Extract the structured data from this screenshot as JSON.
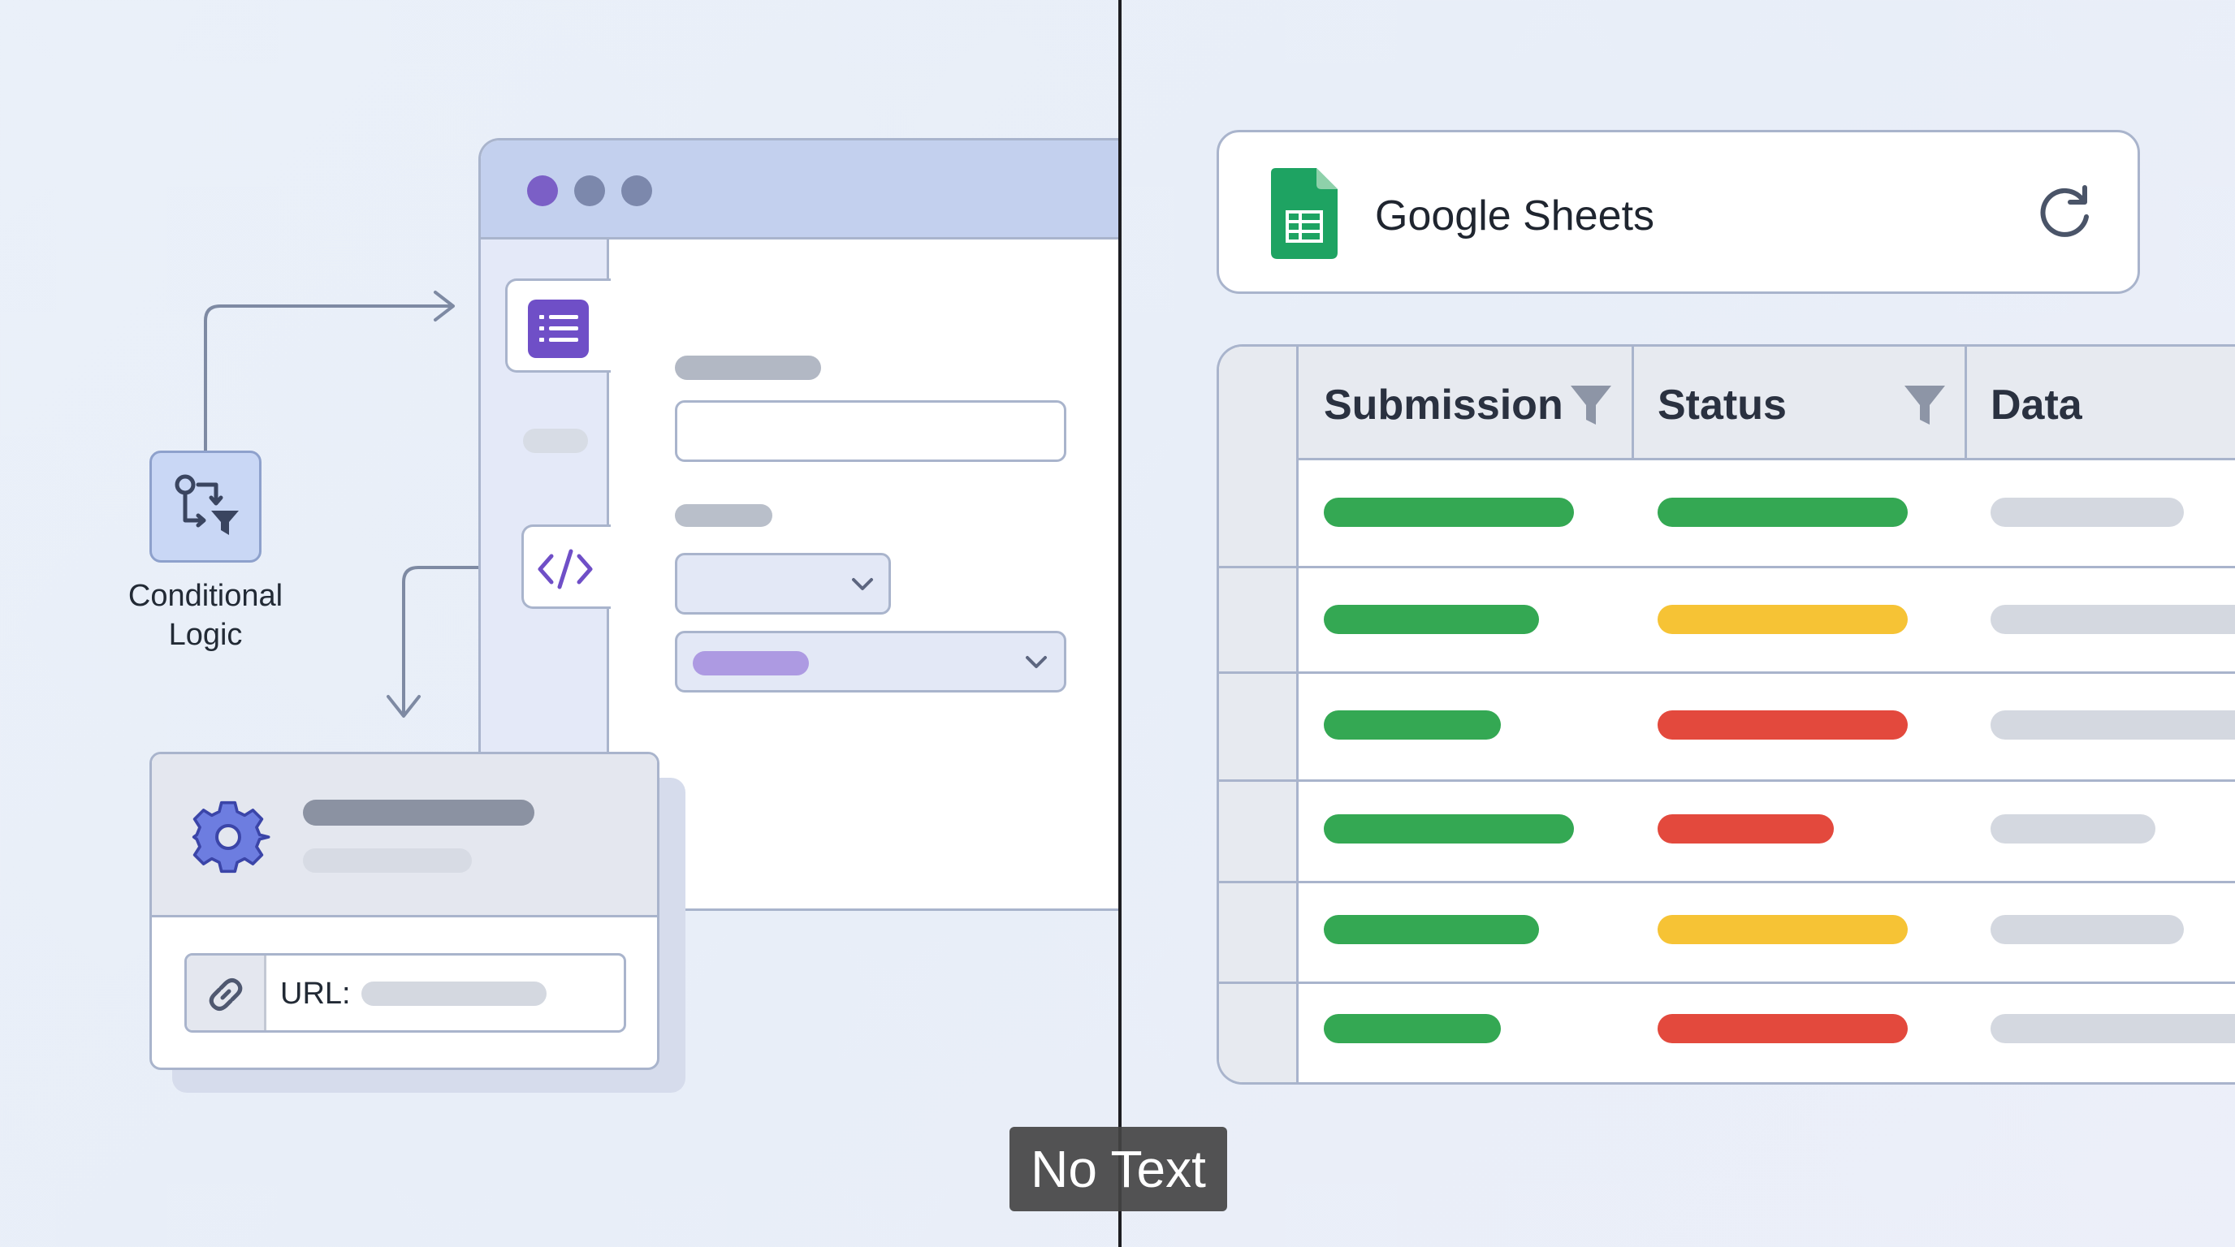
{
  "left_panel": {
    "conditional_logic_label": "Conditional\nLogic",
    "url_label": "URL:"
  },
  "sheets": {
    "title": "Google Sheets",
    "columns": [
      "Submission",
      "Status",
      "Data"
    ],
    "rows": [
      {
        "submission": "green",
        "status": "green",
        "data": "gray"
      },
      {
        "submission": "green",
        "status": "yellow",
        "data": "gray"
      },
      {
        "submission": "green",
        "status": "red",
        "data": "gray"
      },
      {
        "submission": "green",
        "status": "red",
        "data": "gray"
      },
      {
        "submission": "green",
        "status": "yellow",
        "data": "gray"
      },
      {
        "submission": "green",
        "status": "red",
        "data": "gray"
      }
    ]
  },
  "caption": "No Text",
  "colors": {
    "accent_purple": "#6f4fc7",
    "status_green": "#34a853",
    "status_yellow": "#f6c335",
    "status_red": "#e3493d",
    "sheets_green": "#0f9d58"
  },
  "icons": [
    "list-icon",
    "code-icon",
    "conditional-logic-icon",
    "gear-icon",
    "link-icon",
    "google-sheets-icon",
    "refresh-icon",
    "filter-icon",
    "chevron-down-icon"
  ]
}
